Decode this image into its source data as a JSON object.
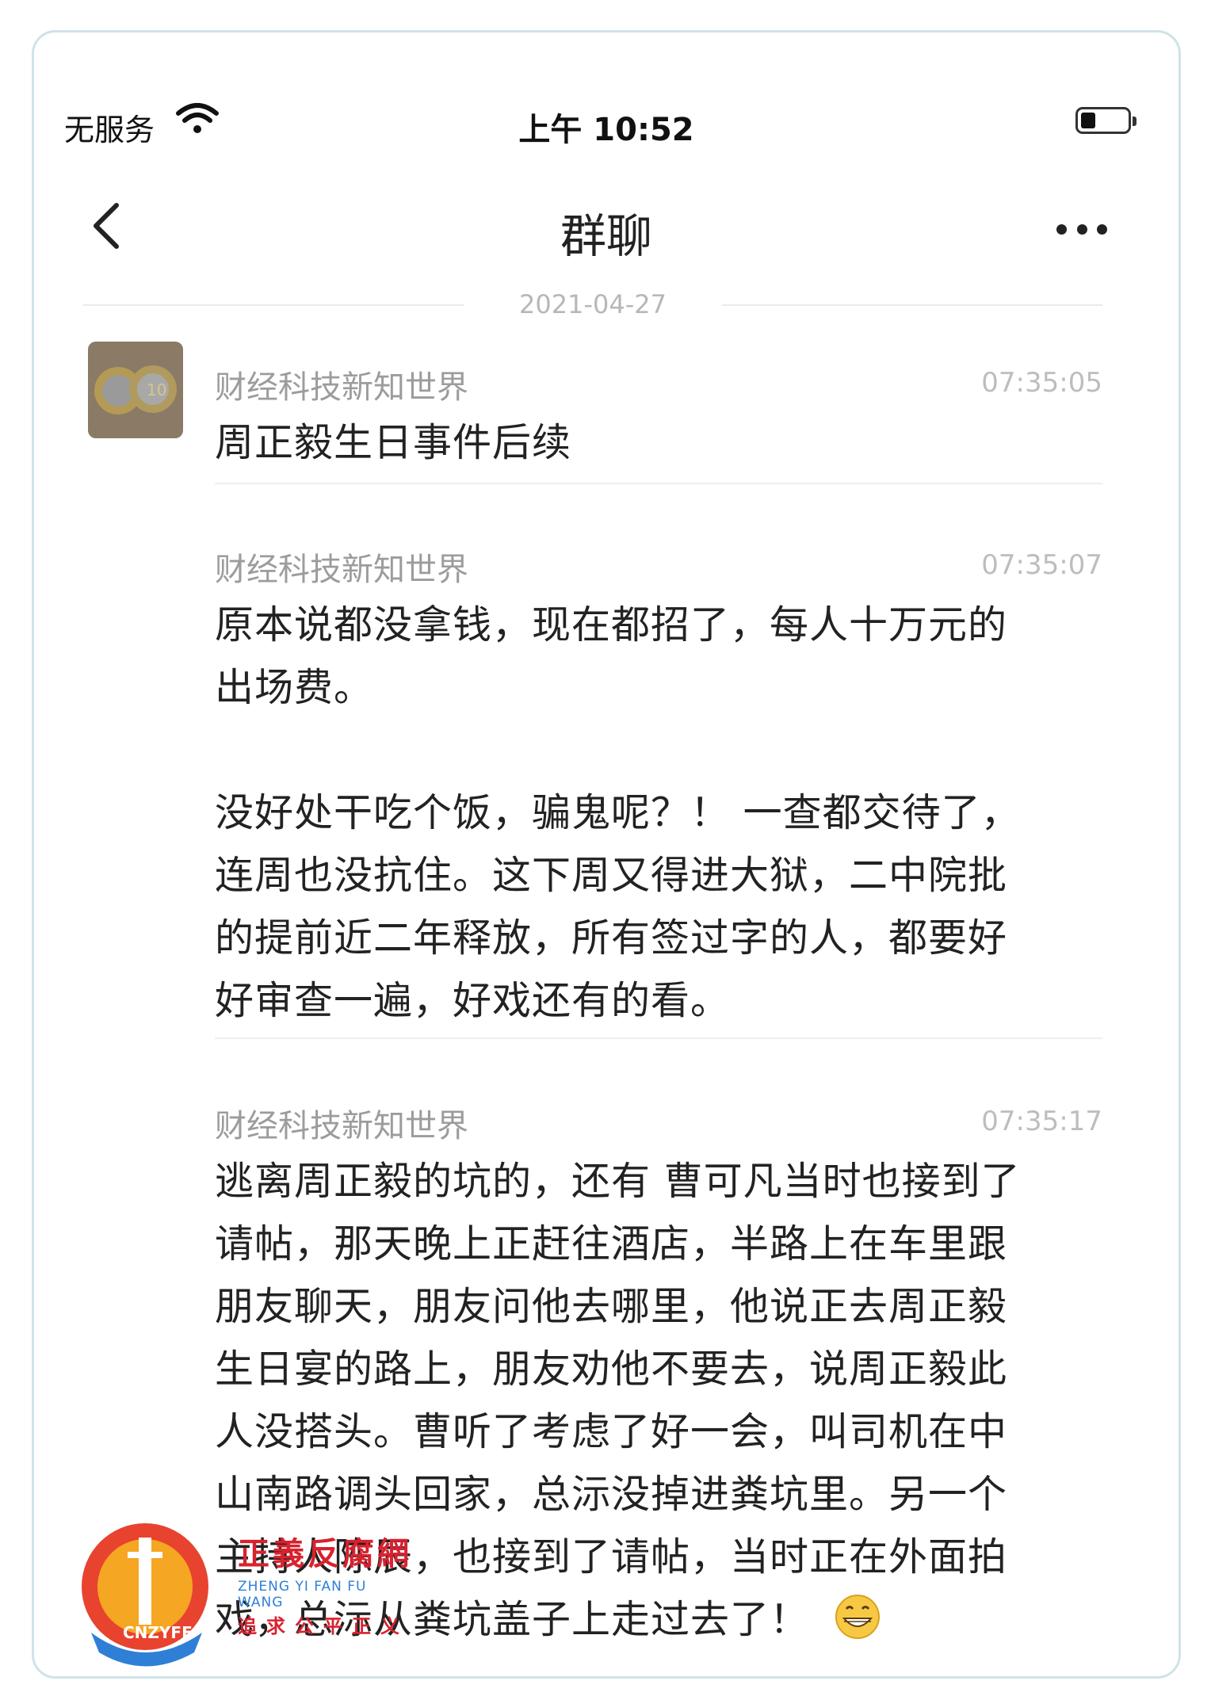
{
  "status_bar": {
    "carrier": "无服务",
    "time": "上午 10:52"
  },
  "nav": {
    "title": "群聊"
  },
  "date_divider": "2021-04-27",
  "messages": [
    {
      "sender": "财经科技新知世界",
      "time": "07:35:05",
      "text": "周正毅生日事件后续"
    },
    {
      "sender": "财经科技新知世界",
      "time": "07:35:07",
      "lines": [
        "原本说都没拿钱，现在都招了，每人十万元的",
        "出场费。",
        "",
        "没好处干吃个饭，骗鬼呢？！ 一查都交待了，",
        "连周也没抗住。这下周又得进大狱，二中院批",
        "的提前近二年释放，所有签过字的人，都要好",
        "好审查一遍，好戏还有的看。"
      ]
    },
    {
      "sender": "财经科技新知世界",
      "time": "07:35:17",
      "lines": [
        "逃离周正毅的坑的，还有 曹可凡当时也接到了",
        "请帖，那天晚上正赶往酒店，半路上在车里跟",
        "朋友聊天，朋友问他去哪里，他说正去周正毅",
        "生日宴的路上，朋友劝他不要去，说周正毅此",
        "人没搭头。曹听了考虑了好一会，叫司机在中",
        "山南路调头回家，总沶没掉进粪坑里。另一个",
        "主持人陈辰，也接到了请帖，当时正在外面拍",
        "戏，总沶从粪坑盖子上走过去了！"
      ],
      "emoji": "grinning-face-emoji"
    }
  ],
  "watermark": {
    "title": "正義反腐網",
    "english": "ZHENG YI FAN FU WANG",
    "subtitle": "追求公平正义",
    "logo_text": "CNZYFF"
  },
  "colors": {
    "frame_border": "#cfe3e8",
    "watermark_red": "#d8222f",
    "watermark_blue": "#2f7fd6"
  }
}
